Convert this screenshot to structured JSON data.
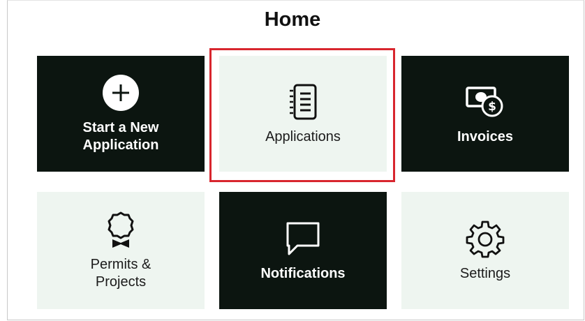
{
  "page": {
    "title": "Home"
  },
  "tiles": [
    {
      "label": "Start a New\nApplication",
      "icon": "plus-circle-icon",
      "style": "dark"
    },
    {
      "label": "Applications",
      "icon": "list-document-icon",
      "style": "light",
      "highlighted": true
    },
    {
      "label": "Invoices",
      "icon": "money-dollar-icon",
      "style": "dark"
    },
    {
      "label": "Permits &\nProjects",
      "icon": "award-ribbon-icon",
      "style": "light"
    },
    {
      "label": "Notifications",
      "icon": "speech-bubble-icon",
      "style": "dark"
    },
    {
      "label": "Settings",
      "icon": "gear-icon",
      "style": "light"
    }
  ],
  "colors": {
    "dark_tile": "#0c1510",
    "light_tile": "#eef5f0",
    "highlight": "#d8262e"
  }
}
